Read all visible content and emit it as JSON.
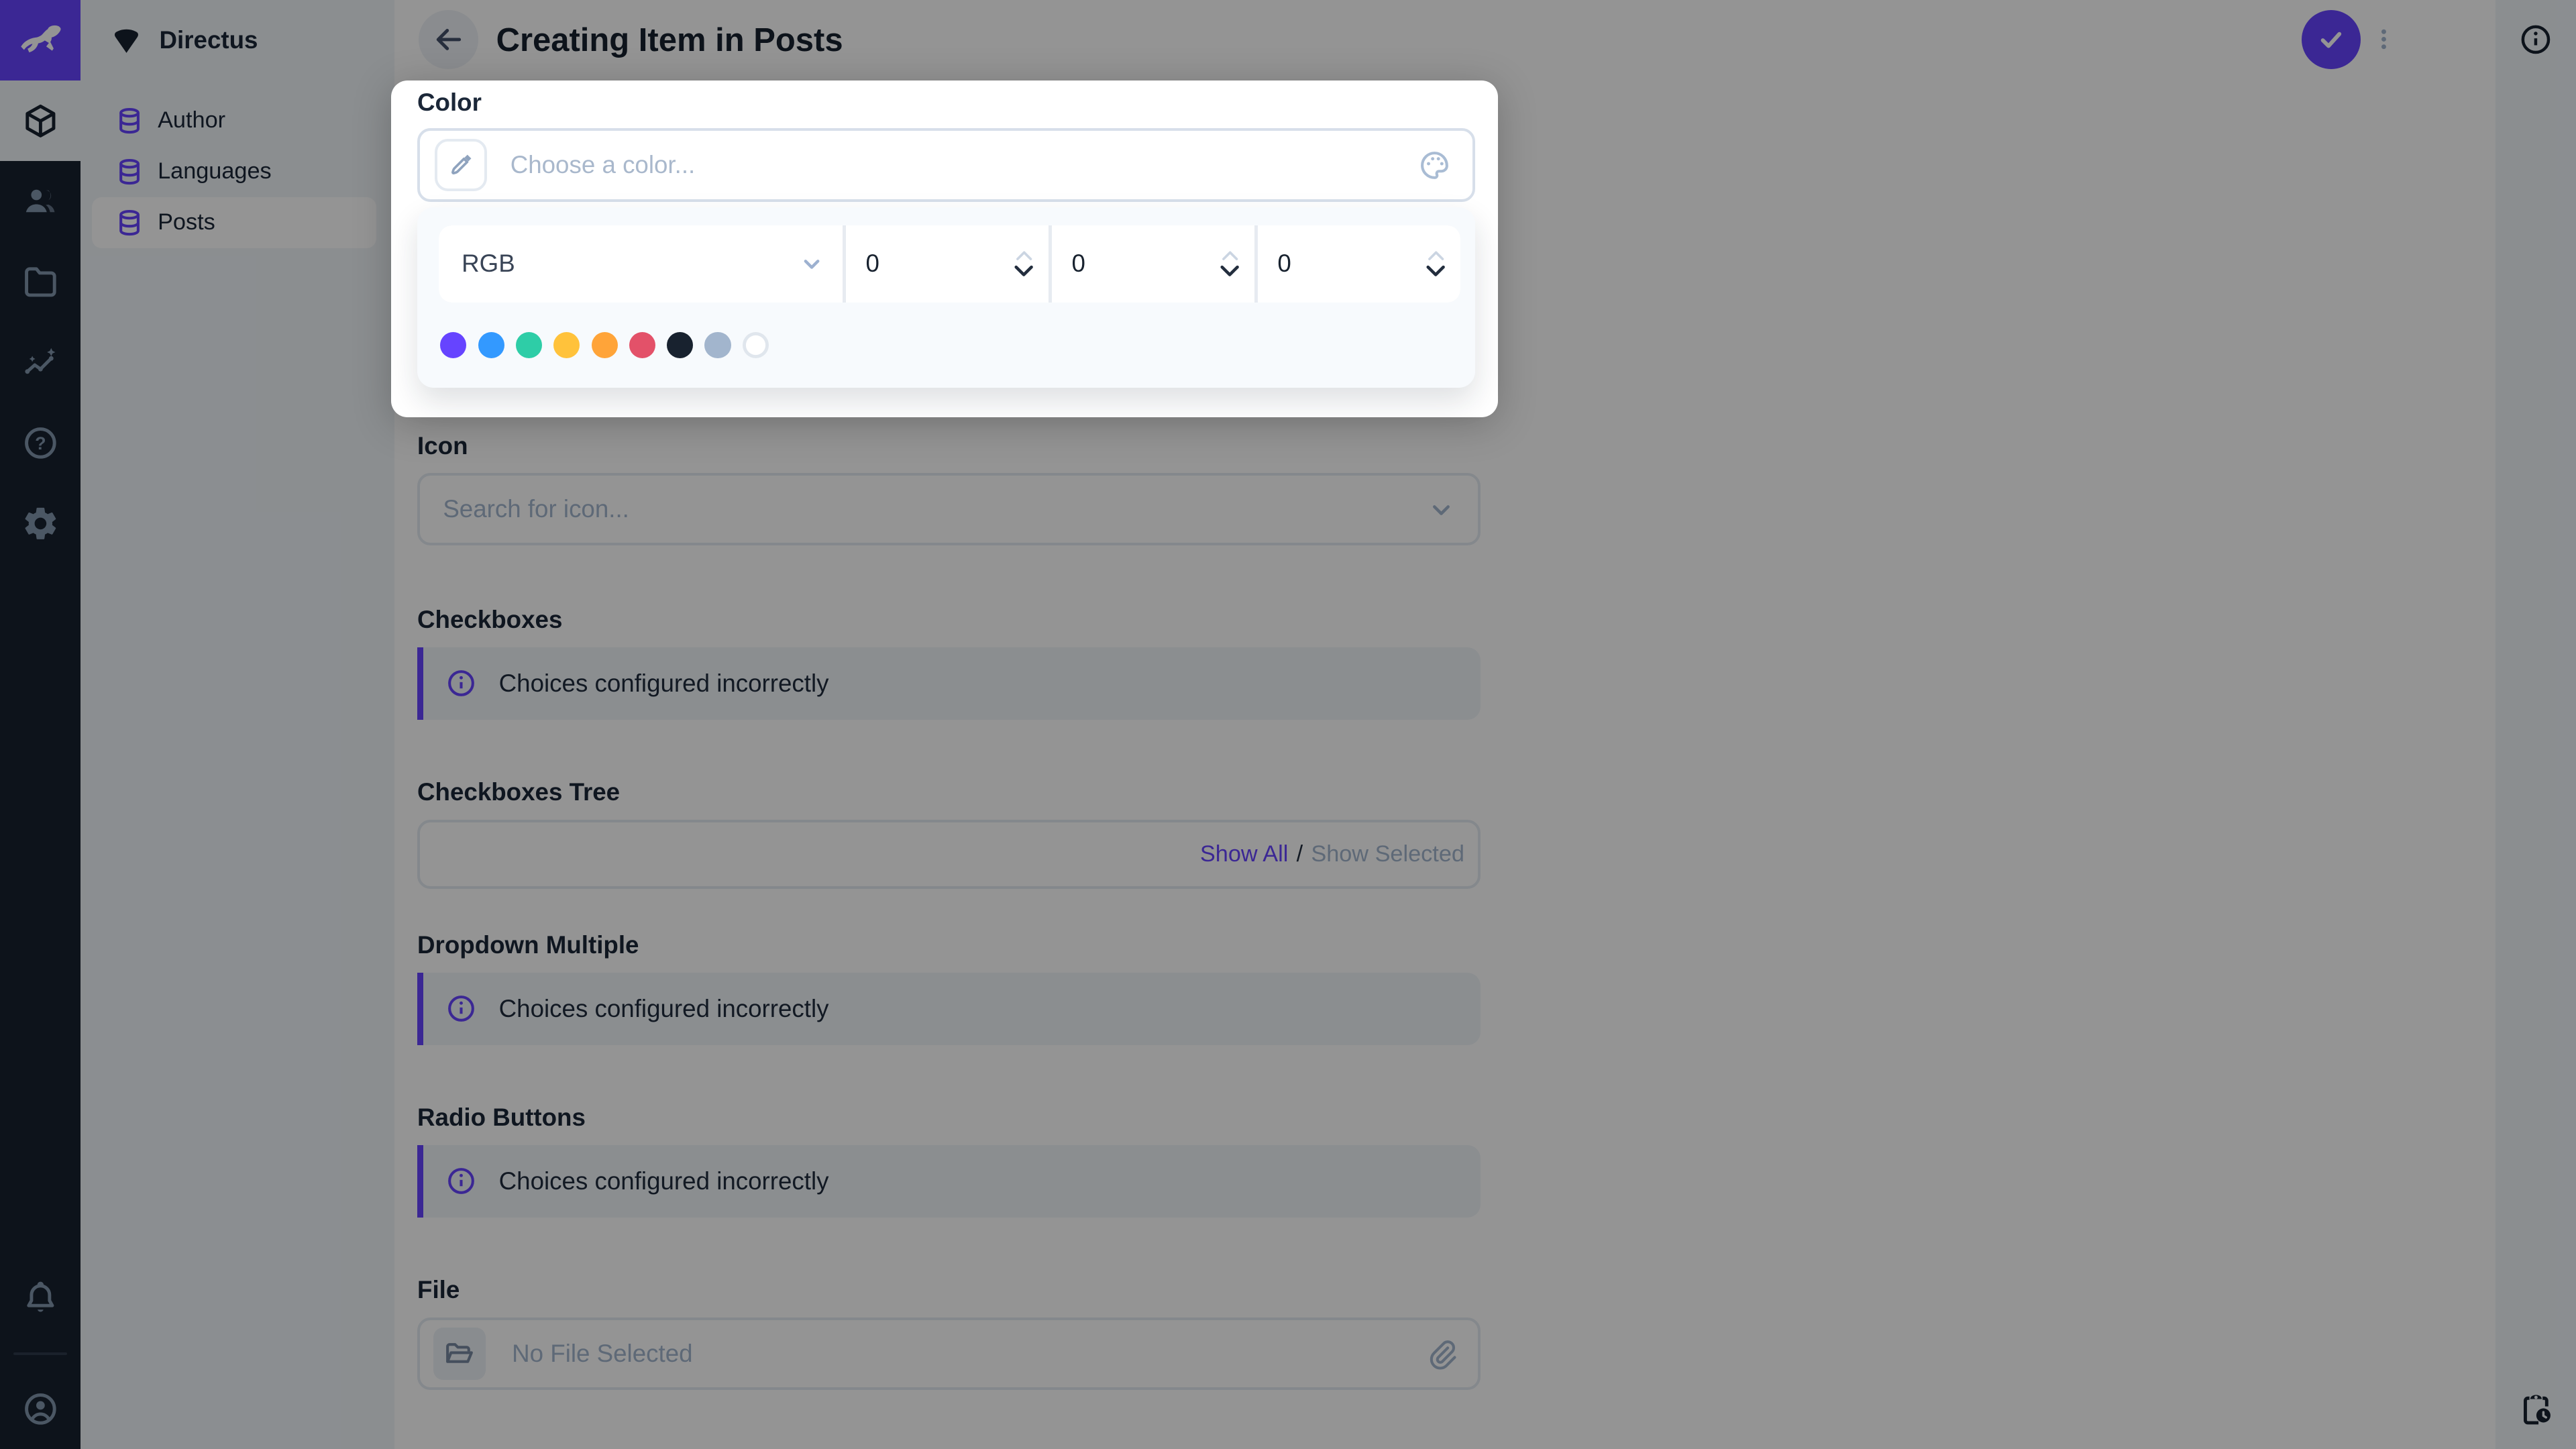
{
  "accent_color": "#6644FF",
  "project": {
    "name": "Directus"
  },
  "module_bar": {
    "modules": [
      "content",
      "users",
      "files",
      "insights",
      "help",
      "settings"
    ],
    "bottom": [
      "notifications",
      "account"
    ]
  },
  "sidebar": {
    "items": [
      {
        "label": "Author"
      },
      {
        "label": "Languages"
      },
      {
        "label": "Posts",
        "active": true
      }
    ]
  },
  "header": {
    "title": "Creating Item in Posts"
  },
  "popup": {
    "field_label": "Color",
    "input_placeholder": "Choose a color...",
    "mode_select": {
      "value": "RGB"
    },
    "channels": [
      {
        "value": "0"
      },
      {
        "value": "0"
      },
      {
        "value": "0"
      }
    ],
    "swatches": [
      {
        "name": "purple",
        "hex": "#6644FF"
      },
      {
        "name": "blue",
        "hex": "#3399FF"
      },
      {
        "name": "green",
        "hex": "#2ECDA7"
      },
      {
        "name": "yellow",
        "hex": "#FFC23B"
      },
      {
        "name": "orange",
        "hex": "#FFA439"
      },
      {
        "name": "red",
        "hex": "#E35169"
      },
      {
        "name": "black",
        "hex": "#18222F"
      },
      {
        "name": "gray",
        "hex": "#A2B5CD"
      },
      {
        "name": "white",
        "hex": "#FFFFFF"
      }
    ]
  },
  "form": {
    "icon": {
      "label": "Icon",
      "placeholder": "Search for icon..."
    },
    "checkboxes": {
      "label": "Checkboxes",
      "notice": "Choices configured incorrectly"
    },
    "checkboxes_tree": {
      "label": "Checkboxes Tree",
      "show_all": "Show All",
      "separator": "/",
      "show_selected": "Show Selected"
    },
    "dropdown_multiple": {
      "label": "Dropdown Multiple",
      "notice": "Choices configured incorrectly"
    },
    "radio_buttons": {
      "label": "Radio Buttons",
      "notice": "Choices configured incorrectly"
    },
    "file": {
      "label": "File",
      "placeholder": "No File Selected"
    }
  }
}
